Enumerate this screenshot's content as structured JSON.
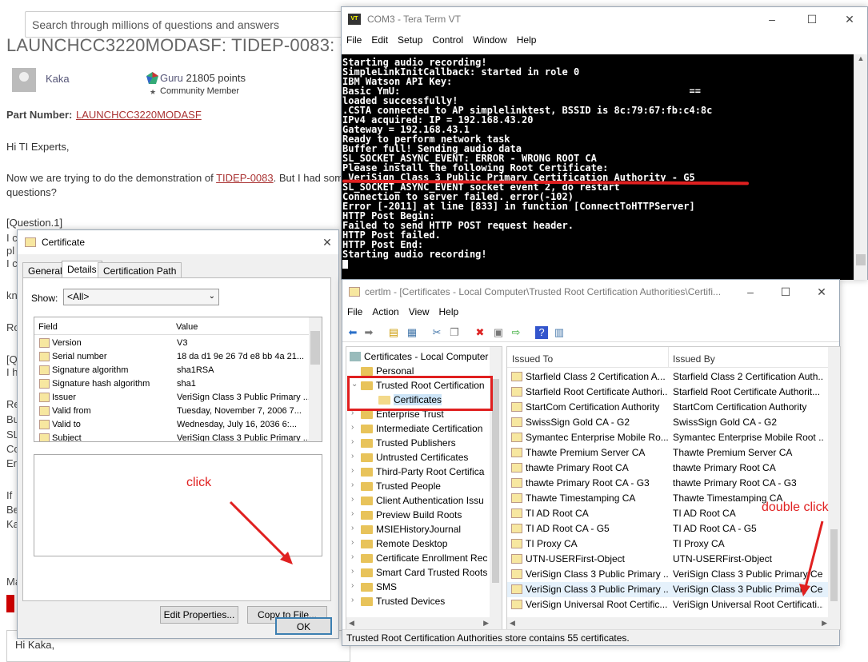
{
  "forum": {
    "search_placeholder": "Search through millions of questions and answers",
    "title": "LAUNCHCC3220MODASF: TIDEP-0083: C",
    "author": "Kaka",
    "rank_label": "Guru",
    "rank_points": "21805 points",
    "member_label": "Community Member",
    "part_label": "Part Number:",
    "part_link": "LAUNCHCC3220MODASF",
    "greeting": "Hi TI Experts,",
    "body_prefix": "Now we are trying to do the demonstration of",
    "body_link": "TIDEP-0083",
    "body_suffix": ". But I had som",
    "body_line2": "questions?",
    "question1": "[Question.1]",
    "fragments": [
      "I c",
      "pl",
      "I c",
      "kn",
      "Ro",
      "[Q",
      "I h",
      "Re",
      "Bu",
      "SL",
      "Co",
      "Er",
      "If",
      "Be",
      "Ka",
      "Ma"
    ],
    "reply_text": "Hi Kaka,"
  },
  "teraterm": {
    "title": "COM3 - Tera Term VT",
    "icon_text": "VT",
    "menu": [
      "File",
      "Edit",
      "Setup",
      "Control",
      "Window",
      "Help"
    ],
    "lines": [
      "Starting audio recording!",
      "SimpleLinkInitCallback: started in role 0",
      "IBM Watson API Key:",
      "Basic YmU:                                                  ==",
      "loaded successfully!",
      ".CSTA connected to AP simplelinktest, BSSID is 8c:79:67:fb:c4:8c",
      "IPv4 acquired: IP = 192.168.43.20",
      "Gateway = 192.168.43.1",
      "Ready to perform network task",
      "Buffer full! Sending audio data",
      "SL_SOCKET_ASYNC_EVENT: ERROR - WRONG ROOT CA",
      "Please install the following Root Certificate:",
      " VeriSign Class 3 Public Primary Certification Authority - G5",
      "SL_SOCKET_ASYNC_EVENT socket event 2, do restart",
      "Connection to server failed. error(-102)",
      "Error [-2011] at line [833] in function [ConnectToHTTPServer]",
      "",
      "HTTP Post Begin:",
      "Failed to send HTTP POST request header.",
      "HTTP Post failed.",
      "HTTP Post End:",
      "Starting audio recording!"
    ]
  },
  "certificate": {
    "title": "Certificate",
    "tabs": [
      "General",
      "Details",
      "Certification Path"
    ],
    "active_tab": "Details",
    "show_label": "Show:",
    "show_value": "<All>",
    "col_field": "Field",
    "col_value": "Value",
    "fields": [
      {
        "name": "Version",
        "value": "V3"
      },
      {
        "name": "Serial number",
        "value": "18 da d1 9e 26 7d e8 bb 4a 21..."
      },
      {
        "name": "Signature algorithm",
        "value": "sha1RSA"
      },
      {
        "name": "Signature hash algorithm",
        "value": "sha1"
      },
      {
        "name": "Issuer",
        "value": "VeriSign Class 3 Public Primary ..."
      },
      {
        "name": "Valid from",
        "value": "Tuesday, November 7, 2006 7..."
      },
      {
        "name": "Valid to",
        "value": "Wednesday, July 16, 2036 6:..."
      },
      {
        "name": "Subject",
        "value": "VeriSign Class 3 Public Primary ..."
      }
    ],
    "edit_properties": "Edit Properties...",
    "copy_to_file": "Copy to File...",
    "ok": "OK"
  },
  "certlm": {
    "title": "certlm - [Certificates - Local Computer\\Trusted Root Certification Authorities\\Certifi...",
    "menu": [
      "File",
      "Action",
      "View",
      "Help"
    ],
    "tree_root": "Certificates - Local Computer",
    "tree": [
      "Personal",
      "Trusted Root Certification",
      "Certificates",
      "Enterprise Trust",
      "Intermediate Certification",
      "Trusted Publishers",
      "Untrusted Certificates",
      "Third-Party Root Certifica",
      "Trusted People",
      "Client Authentication Issu",
      "Preview Build Roots",
      "MSIEHistoryJournal",
      "Remote Desktop",
      "Certificate Enrollment Rec",
      "Smart Card Trusted Roots",
      "SMS",
      "Trusted Devices"
    ],
    "col_issued_to": "Issued To",
    "col_issued_by": "Issued By",
    "rows": [
      {
        "to": "Starfield Class 2 Certification A...",
        "by": "Starfield Class 2 Certification Auth..."
      },
      {
        "to": "Starfield Root Certificate Authori...",
        "by": "Starfield Root Certificate Authorit..."
      },
      {
        "to": "StartCom Certification Authority",
        "by": "StartCom Certification Authority"
      },
      {
        "to": "SwissSign Gold CA - G2",
        "by": "SwissSign Gold CA - G2"
      },
      {
        "to": "Symantec Enterprise Mobile Ro...",
        "by": "Symantec Enterprise Mobile Root ..."
      },
      {
        "to": "Thawte Premium Server CA",
        "by": "Thawte Premium Server CA"
      },
      {
        "to": "thawte Primary Root CA",
        "by": "thawte Primary Root CA"
      },
      {
        "to": "thawte Primary Root CA - G3",
        "by": "thawte Primary Root CA - G3"
      },
      {
        "to": "Thawte Timestamping CA",
        "by": "Thawte Timestamping CA"
      },
      {
        "to": "TI AD Root CA",
        "by": "TI AD Root CA"
      },
      {
        "to": "TI AD Root CA - G5",
        "by": "TI AD Root CA - G5"
      },
      {
        "to": "TI Proxy CA",
        "by": "TI Proxy CA"
      },
      {
        "to": "UTN-USERFirst-Object",
        "by": "UTN-USERFirst-Object"
      },
      {
        "to": "VeriSign Class 3 Public Primary ...",
        "by": "VeriSign Class 3 Public Primary Ce..."
      },
      {
        "to": "VeriSign Class 3 Public Primary ...",
        "by": "VeriSign Class 3 Public Primary Ce..."
      },
      {
        "to": "VeriSign Universal Root Certific...",
        "by": "VeriSign Universal Root Certificati..."
      }
    ],
    "status": "Trusted Root Certification Authorities store contains 55 certificates."
  },
  "annotations": {
    "click": "click",
    "double_click": "double click"
  },
  "colors": {
    "annotation_red": "#e02020",
    "terminal_bg": "#000000",
    "link_red": "#a33333",
    "selection_blue": "#cce4f7"
  }
}
